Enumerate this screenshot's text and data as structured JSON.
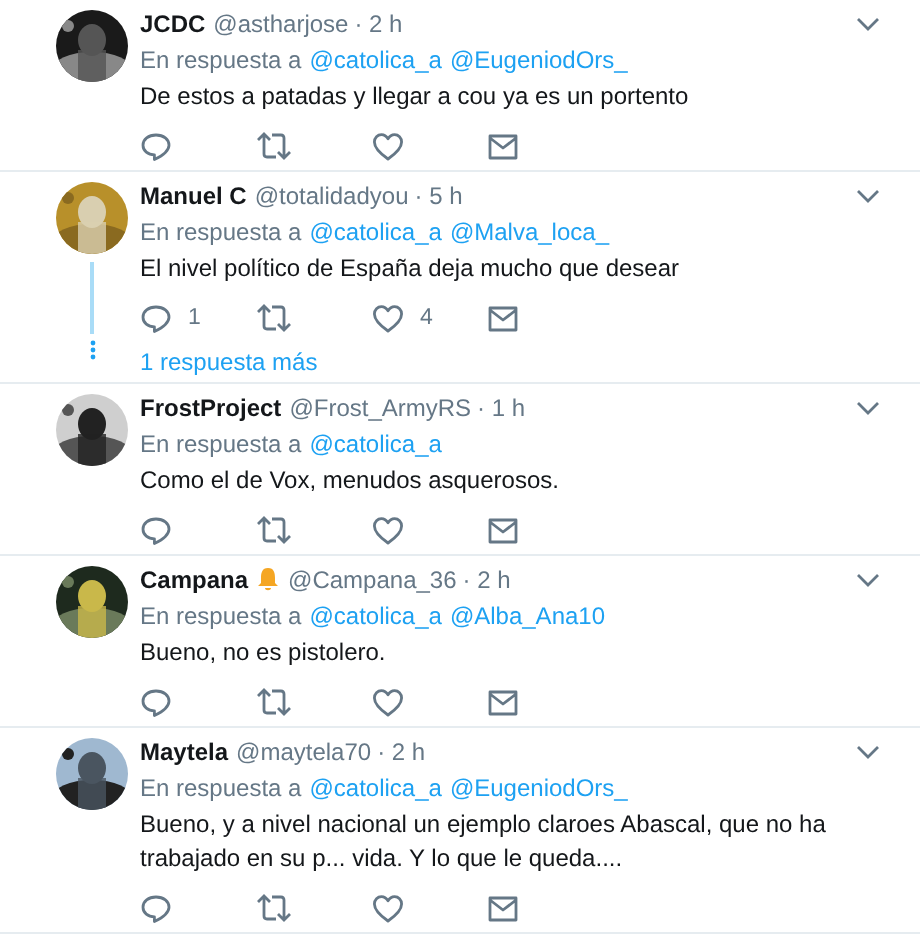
{
  "tweets": [
    {
      "name": "JCDC",
      "handle": "@astharjose",
      "time": "· 2 h",
      "reply_prefix": "En respuesta a",
      "mentions": [
        "@catolica_a",
        "@EugeniodOrs_"
      ],
      "text": "De estos a patadas y llegar a cou ya es un portento"
    },
    {
      "name": "Manuel C",
      "handle": "@totalidadyou",
      "time": "· 5 h",
      "reply_prefix": "En respuesta a",
      "mentions": [
        "@catolica_a",
        "@Malva_loca_"
      ],
      "text": "El nivel político de España deja mucho que desear",
      "reply_count": "1",
      "like_count": "4",
      "thread": true,
      "more_replies": "1 respuesta más"
    },
    {
      "name": "FrostProject",
      "handle": "@Frost_ArmyRS",
      "time": "· 1 h",
      "reply_prefix": "En respuesta a",
      "mentions": [
        "@catolica_a"
      ],
      "text": "Como el de Vox, menudos asquerosos."
    },
    {
      "name": "Campana",
      "bell_badge": true,
      "handle": "@Campana_36",
      "time": "· 2 h",
      "reply_prefix": "En respuesta a",
      "mentions": [
        "@catolica_a",
        "@Alba_Ana10"
      ],
      "text": "Bueno, no es pistolero."
    },
    {
      "name": "Maytela",
      "handle": "@maytela70",
      "time": "· 2 h",
      "reply_prefix": "En respuesta a",
      "mentions": [
        "@catolica_a",
        "@EugeniodOrs_"
      ],
      "text": "Bueno, y a nivel nacional un ejemplo claroes Abascal, que no ha trabajado en su p... vida. Y lo que le queda...."
    }
  ]
}
